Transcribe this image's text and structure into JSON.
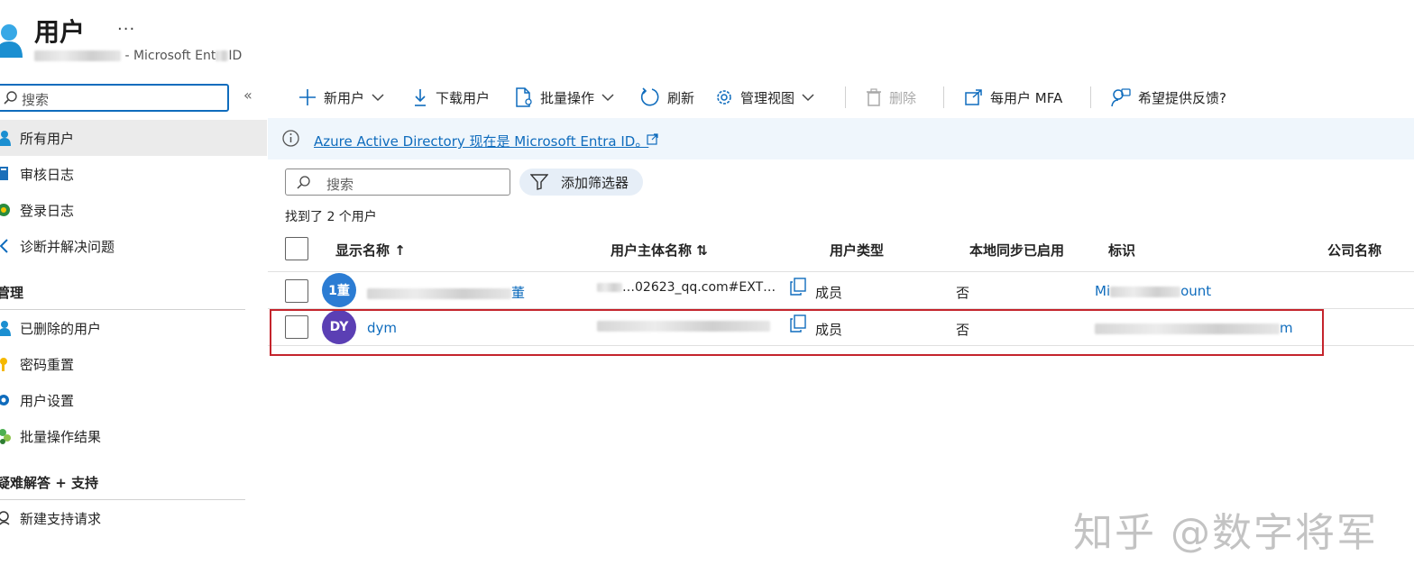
{
  "header": {
    "title": "用户",
    "more": "···",
    "subtitle_suffix": "- Microsoft Ent",
    "subtitle_suffix2": "ID"
  },
  "sidebar": {
    "search_placeholder": "搜索",
    "collapse": "«",
    "items": [
      {
        "label": "所有用户"
      },
      {
        "label": "审核日志"
      },
      {
        "label": "登录日志"
      },
      {
        "label": "诊断并解决问题"
      }
    ],
    "section_manage": "管理",
    "manage_items": [
      {
        "label": "已删除的用户"
      },
      {
        "label": "密码重置"
      },
      {
        "label": "用户设置"
      },
      {
        "label": "批量操作结果"
      }
    ],
    "section_support": "疑难解答 + 支持",
    "support_items": [
      {
        "label": "新建支持请求"
      }
    ]
  },
  "toolbar": {
    "new_user": "新用户",
    "download": "下载用户",
    "bulk": "批量操作",
    "refresh": "刷新",
    "manage_view": "管理视图",
    "delete": "删除",
    "per_user_mfa": "每用户 MFA",
    "feedback": "希望提供反馈?"
  },
  "banner": {
    "text": "Azure Active Directory 现在是 Microsoft Entra ID。"
  },
  "filters": {
    "search_placeholder": "搜索",
    "add_filter": "添加筛选器",
    "found": "找到了 2 个用户"
  },
  "table": {
    "headers": {
      "display_name": "显示名称 ↑",
      "upn": "用户主体名称 ⇅",
      "user_type": "用户类型",
      "sync": "本地同步已启用",
      "identity": "标识",
      "company": "公司名称"
    },
    "rows": [
      {
        "avatar": "1董",
        "avatar_color": "#2b7cd3",
        "name_suffix": "董",
        "upn_visible": "…02623_qq.com#EXT…",
        "type": "成员",
        "sync": "否",
        "identity_prefix": "Mi",
        "identity_suffix": "ount"
      },
      {
        "avatar": "DY",
        "avatar_color": "#5b3fb4",
        "name": "dym",
        "type": "成员",
        "sync": "否",
        "identity_suffix": "m"
      }
    ]
  },
  "watermark": "知乎 @数字将军"
}
